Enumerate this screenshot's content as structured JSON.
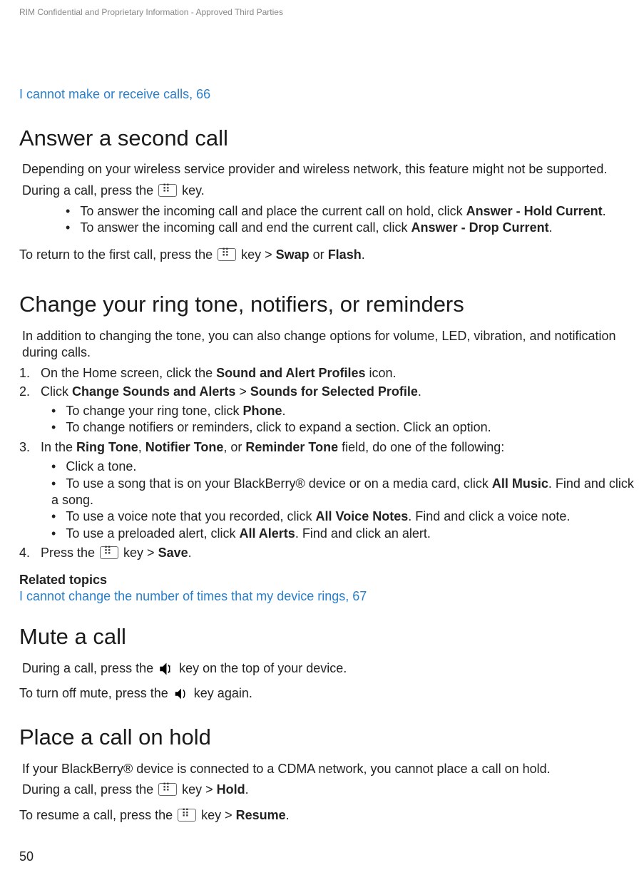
{
  "confidential": "RIM Confidential and Proprietary Information - Approved Third Parties",
  "link1": "I cannot make or receive calls, 66",
  "sec1": {
    "heading": "Answer a second call",
    "p1": "Depending on your wireless service provider and wireless network, this feature might not be supported.",
    "p2a": "During a call, press the ",
    "p2b": " key.",
    "b1a": "To answer the incoming call and place the current call on hold, click ",
    "b1b": "Answer - Hold Current",
    "b2a": "To answer the incoming call and end the current call, click ",
    "b2b": "Answer - Drop Current",
    "p3a": "To return to the first call, press the ",
    "p3b": " key > ",
    "p3c": "Swap",
    "p3d": " or ",
    "p3e": "Flash",
    "period": "."
  },
  "sec2": {
    "heading": "Change your ring tone, notifiers, or reminders",
    "p1": "In addition to changing the tone, you can also change options for volume, LED, vibration, and notification during calls.",
    "step1a": "On the Home screen, click the ",
    "step1b": "Sound and Alert Profiles",
    "step1c": " icon.",
    "step2a": "Click ",
    "step2b": "Change Sounds and Alerts",
    "step2c": " > ",
    "step2d": "Sounds for Selected Profile",
    "step2_b1a": "To change your ring tone, click ",
    "step2_b1b": "Phone",
    "step2_b2": "To change notifiers or reminders, click to expand a section. Click an option.",
    "step3a": "In the ",
    "step3b": "Ring Tone",
    "step3c": ", ",
    "step3d": "Notifier Tone",
    "step3e": ", or ",
    "step3f": "Reminder Tone",
    "step3g": " field, do one of the following:",
    "step3_b1": "Click a tone.",
    "step3_b2a": "To use a song that is on your BlackBerry® device or on a media card, click ",
    "step3_b2b": "All Music",
    "step3_b2c": ". Find and click a song.",
    "step3_b3a": "To use a voice note that you recorded, click ",
    "step3_b3b": "All Voice Notes",
    "step3_b3c": ". Find and click a voice note.",
    "step3_b4a": "To use a preloaded alert, click ",
    "step3_b4b": "All Alerts",
    "step3_b4c": ". Find and click an alert.",
    "step4a": "Press the ",
    "step4b": " key > ",
    "step4c": "Save",
    "related_title": "Related topics",
    "related_link": "I cannot change the number of times that my device rings, 67"
  },
  "sec3": {
    "heading": "Mute a call",
    "p1a": "During a call, press the ",
    "p1b": " key on the top of your device.",
    "p2a": "To turn off mute, press the ",
    "p2b": " key again."
  },
  "sec4": {
    "heading": "Place a call on hold",
    "p1": "If your BlackBerry® device is connected to a CDMA network, you cannot place a call on hold.",
    "p2a": "During a call, press the ",
    "p2b": " key > ",
    "p2c": "Hold",
    "p3a": "To resume a call, press the ",
    "p3b": " key > ",
    "p3c": "Resume"
  },
  "page_num": "50",
  "nums": {
    "n1": "1.",
    "n2": "2.",
    "n3": "3.",
    "n4": "4."
  }
}
